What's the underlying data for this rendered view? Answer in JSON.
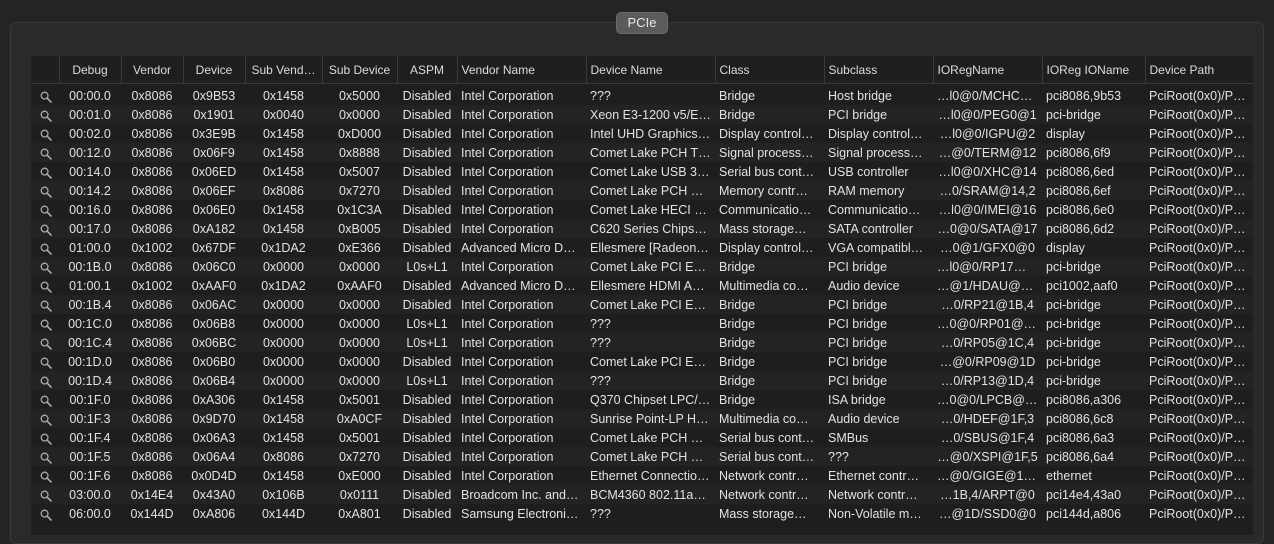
{
  "segment_label": "PCIe",
  "columns": [
    "",
    "Debug",
    "Vendor",
    "Device",
    "Sub Vend…",
    "Sub Device",
    "ASPM",
    "Vendor Name",
    "Device Name",
    "Class",
    "Subclass",
    "IORegName",
    "IOReg IOName",
    "Device Path"
  ],
  "rows": [
    [
      "00:00.0",
      "0x8086",
      "0x9B53",
      "0x1458",
      "0x5000",
      "Disabled",
      "Intel Corporation",
      "???",
      "Bridge",
      "Host bridge",
      "…l0@0/MCHC@0",
      "pci8086,9b53",
      "PciRoot(0x0)/P…"
    ],
    [
      "00:01.0",
      "0x8086",
      "0x1901",
      "0x0040",
      "0x0000",
      "Disabled",
      "Intel Corporation",
      "Xeon E3-1200 v5/E…",
      "Bridge",
      "PCI bridge",
      "…l0@0/PEG0@1",
      "pci-bridge",
      "PciRoot(0x0)/P…"
    ],
    [
      "00:02.0",
      "0x8086",
      "0x3E9B",
      "0x1458",
      "0xD000",
      "Disabled",
      "Intel Corporation",
      "Intel UHD Graphics…",
      "Display control…",
      "Display control…",
      "…l0@0/IGPU@2",
      "display",
      "PciRoot(0x0)/P…"
    ],
    [
      "00:12.0",
      "0x8086",
      "0x06F9",
      "0x1458",
      "0x8888",
      "Disabled",
      "Intel Corporation",
      "Comet Lake PCH T…",
      "Signal process…",
      "Signal process…",
      "…@0/TERM@12",
      "pci8086,6f9",
      "PciRoot(0x0)/P…"
    ],
    [
      "00:14.0",
      "0x8086",
      "0x06ED",
      "0x1458",
      "0x5007",
      "Disabled",
      "Intel Corporation",
      "Comet Lake USB 3…",
      "Serial bus cont…",
      "USB controller",
      "…l0@0/XHC@14",
      "pci8086,6ed",
      "PciRoot(0x0)/P…"
    ],
    [
      "00:14.2",
      "0x8086",
      "0x06EF",
      "0x8086",
      "0x7270",
      "Disabled",
      "Intel Corporation",
      "Comet Lake PCH S…",
      "Memory contr…",
      "RAM memory",
      "…0/SRAM@14,2",
      "pci8086,6ef",
      "PciRoot(0x0)/P…"
    ],
    [
      "00:16.0",
      "0x8086",
      "0x06E0",
      "0x1458",
      "0x1C3A",
      "Disabled",
      "Intel Corporation",
      "Comet Lake HECI C…",
      "Communicatio…",
      "Communicatio…",
      "…l0@0/IMEI@16",
      "pci8086,6e0",
      "PciRoot(0x0)/P…"
    ],
    [
      "00:17.0",
      "0x8086",
      "0xA182",
      "0x1458",
      "0xB005",
      "Disabled",
      "Intel Corporation",
      "C620 Series Chipse…",
      "Mass storage…",
      "SATA controller",
      "…0@0/SATA@17",
      "pci8086,6d2",
      "PciRoot(0x0)/P…"
    ],
    [
      "01:00.0",
      "0x1002",
      "0x67DF",
      "0x1DA2",
      "0xE366",
      "Disabled",
      "Advanced Micro De…",
      "Ellesmere [Radeon…",
      "Display control…",
      "VGA compatibl…",
      "…0@1/GFX0@0",
      "display",
      "PciRoot(0x0)/P…"
    ],
    [
      "00:1B.0",
      "0x8086",
      "0x06C0",
      "0x0000",
      "0x0000",
      "L0s+L1",
      "Intel Corporation",
      "Comet Lake PCI Ex…",
      "Bridge",
      "PCI bridge",
      "…l0@0/RP17@1B",
      "pci-bridge",
      "PciRoot(0x0)/P…"
    ],
    [
      "01:00.1",
      "0x1002",
      "0xAAF0",
      "0x1DA2",
      "0xAAF0",
      "Disabled",
      "Advanced Micro De…",
      "Ellesmere HDMI Au…",
      "Multimedia co…",
      "Audio device",
      "…@1/HDAU@0,1",
      "pci1002,aaf0",
      "PciRoot(0x0)/P…"
    ],
    [
      "00:1B.4",
      "0x8086",
      "0x06AC",
      "0x0000",
      "0x0000",
      "Disabled",
      "Intel Corporation",
      "Comet Lake PCI Ex…",
      "Bridge",
      "PCI bridge",
      "…0/RP21@1B,4",
      "pci-bridge",
      "PciRoot(0x0)/P…"
    ],
    [
      "00:1C.0",
      "0x8086",
      "0x06B8",
      "0x0000",
      "0x0000",
      "L0s+L1",
      "Intel Corporation",
      "???",
      "Bridge",
      "PCI bridge",
      "…0@0/RP01@1C",
      "pci-bridge",
      "PciRoot(0x0)/P…"
    ],
    [
      "00:1C.4",
      "0x8086",
      "0x06BC",
      "0x0000",
      "0x0000",
      "L0s+L1",
      "Intel Corporation",
      "???",
      "Bridge",
      "PCI bridge",
      "…0/RP05@1C,4",
      "pci-bridge",
      "PciRoot(0x0)/P…"
    ],
    [
      "00:1D.0",
      "0x8086",
      "0x06B0",
      "0x0000",
      "0x0000",
      "Disabled",
      "Intel Corporation",
      "Comet Lake PCI Ex…",
      "Bridge",
      "PCI bridge",
      "…@0/RP09@1D",
      "pci-bridge",
      "PciRoot(0x0)/P…"
    ],
    [
      "00:1D.4",
      "0x8086",
      "0x06B4",
      "0x0000",
      "0x0000",
      "L0s+L1",
      "Intel Corporation",
      "???",
      "Bridge",
      "PCI bridge",
      "…0/RP13@1D,4",
      "pci-bridge",
      "PciRoot(0x0)/P…"
    ],
    [
      "00:1F.0",
      "0x8086",
      "0xA306",
      "0x1458",
      "0x5001",
      "Disabled",
      "Intel Corporation",
      "Q370 Chipset LPC/…",
      "Bridge",
      "ISA bridge",
      "…0@0/LPCB@1F",
      "pci8086,a306",
      "PciRoot(0x0)/P…"
    ],
    [
      "00:1F.3",
      "0x8086",
      "0x9D70",
      "0x1458",
      "0xA0CF",
      "Disabled",
      "Intel Corporation",
      "Sunrise Point-LP H…",
      "Multimedia co…",
      "Audio device",
      "…0/HDEF@1F,3",
      "pci8086,6c8",
      "PciRoot(0x0)/P…"
    ],
    [
      "00:1F.4",
      "0x8086",
      "0x06A3",
      "0x1458",
      "0x5001",
      "Disabled",
      "Intel Corporation",
      "Comet Lake PCH S…",
      "Serial bus cont…",
      "SMBus",
      "…0/SBUS@1F,4",
      "pci8086,6a3",
      "PciRoot(0x0)/P…"
    ],
    [
      "00:1F.5",
      "0x8086",
      "0x06A4",
      "0x8086",
      "0x7270",
      "Disabled",
      "Intel Corporation",
      "Comet Lake PCH S…",
      "Serial bus cont…",
      "???",
      "…@0/XSPI@1F,5",
      "pci8086,6a4",
      "PciRoot(0x0)/P…"
    ],
    [
      "00:1F.6",
      "0x8086",
      "0x0D4D",
      "0x1458",
      "0xE000",
      "Disabled",
      "Intel Corporation",
      "Ethernet Connectio…",
      "Network contr…",
      "Ethernet contr…",
      "…@0/GIGE@1F,6",
      "ethernet",
      "PciRoot(0x0)/P…"
    ],
    [
      "03:00.0",
      "0x14E4",
      "0x43A0",
      "0x106B",
      "0x0111",
      "Disabled",
      "Broadcom Inc. and…",
      "BCM4360 802.11ac…",
      "Network contr…",
      "Network contr…",
      "…1B,4/ARPT@0",
      "pci14e4,43a0",
      "PciRoot(0x0)/P…"
    ],
    [
      "06:00.0",
      "0x144D",
      "0xA806",
      "0x144D",
      "0xA801",
      "Disabled",
      "Samsung Electronic…",
      "???",
      "Mass storage…",
      "Non-Volatile m…",
      "…@1D/SSD0@0",
      "pci144d,a806",
      "PciRoot(0x0)/P…"
    ]
  ]
}
